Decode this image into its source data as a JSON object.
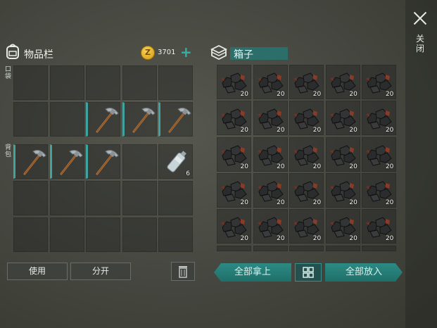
{
  "inventory": {
    "title": "物品栏",
    "pocket_label": "口袋",
    "backpack_label": "背包",
    "coins": "3701"
  },
  "chest": {
    "title": "箱子"
  },
  "close_label": "关闭",
  "actions": {
    "use": "使用",
    "split": "分开"
  },
  "chest_actions": {
    "take_all": "全部拿上",
    "put_all": "全部放入"
  },
  "items": {
    "pickaxe": "pickaxe-icon",
    "bottle_qty": "6",
    "resource_qty": "20"
  },
  "colors": {
    "accent": "#2c8a84",
    "coin": "#e8b730",
    "plus": "#2fb3a8"
  }
}
